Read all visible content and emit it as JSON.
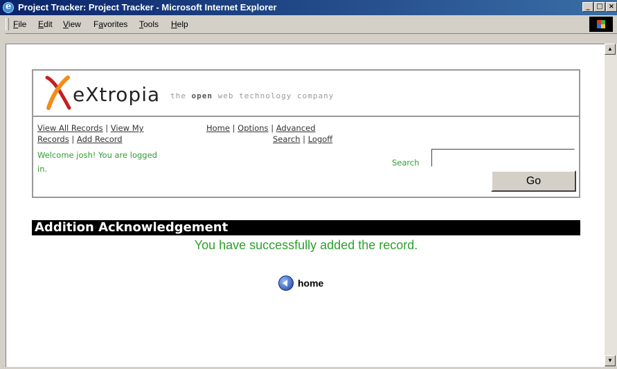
{
  "window": {
    "title": "Project Tracker: Project Tracker - Microsoft Internet Explorer"
  },
  "menu": {
    "items": [
      "File",
      "Edit",
      "View",
      "Favorites",
      "Tools",
      "Help"
    ]
  },
  "header": {
    "logo_word": "eXtropia",
    "tagline_pre": "the ",
    "tagline_bold": "open",
    "tagline_post": " web technology company"
  },
  "nav": {
    "view_all": "View All Records",
    "view_my_1": "View My",
    "view_my_2": "Records",
    "add_record": "Add Record",
    "home": "Home",
    "options": "Options",
    "advanced_1": "Advanced",
    "advanced_2": "Search",
    "logoff": "Logoff",
    "sep": "|"
  },
  "welcome": {
    "line1": "Welcome josh! You are logged",
    "line2": "in."
  },
  "search": {
    "label": "Search",
    "value": "",
    "button": "Go"
  },
  "content": {
    "heading": "Addition Acknowledgement",
    "message": "You have successfully added the record.",
    "home_link": "home"
  },
  "colors": {
    "accent_green": "#2e9e2e",
    "title_bar": "#0a246a",
    "logo_orange": "#f28c1a",
    "logo_red": "#c81e1e"
  }
}
